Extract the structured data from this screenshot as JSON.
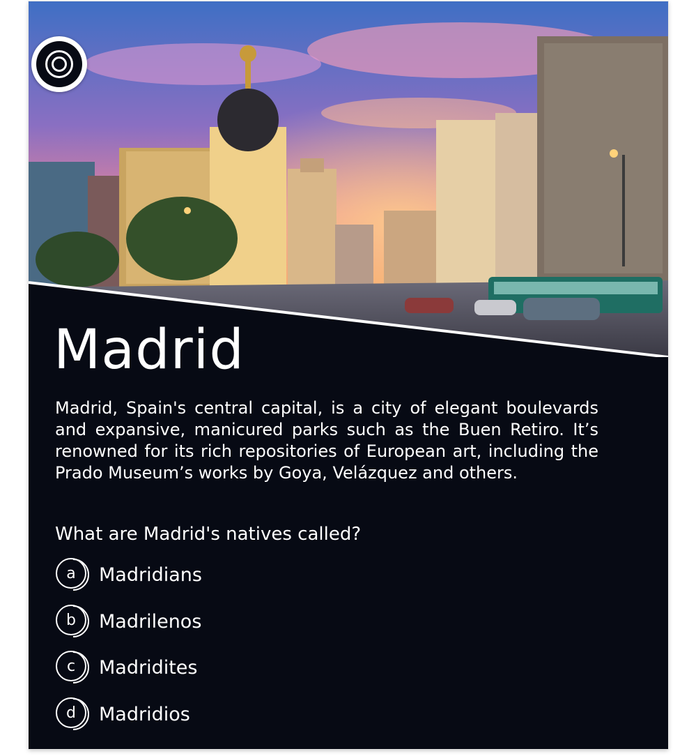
{
  "quiz": {
    "title": "Madrid",
    "description": "Madrid, Spain's central capital, is a city of elegant boulevards and expansive, manicured parks such as the Buen Retiro. It’s renowned for its rich repositories of European art, including the Prado Museum’s works by Goya, Velázquez and others.",
    "question": "What are Madrid's natives called?",
    "badge_icon": "concentric-circles-icon",
    "hero_image": "madrid-gran-via-sunset-photo",
    "options": [
      {
        "letter": "a",
        "label": "Madridians"
      },
      {
        "letter": "b",
        "label": "Madrilenos"
      },
      {
        "letter": "c",
        "label": "Madridites"
      },
      {
        "letter": "d",
        "label": "Madridios"
      }
    ]
  },
  "colors": {
    "card_background": "#070a14",
    "text": "#ffffff",
    "page_background": "#ffffff"
  }
}
